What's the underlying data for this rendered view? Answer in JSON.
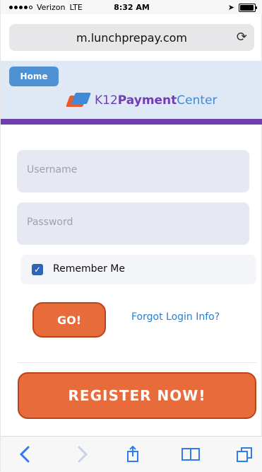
{
  "status_bar": {
    "carrier": "Verizon",
    "network": "LTE",
    "time": "8:32 AM"
  },
  "browser": {
    "url": "m.lunchprepay.com",
    "reload_icon": "reload-icon"
  },
  "header": {
    "home_label": "Home",
    "logo_text_k12": "K12",
    "logo_text_payment": "Payment",
    "logo_text_center": "Center",
    "colors": {
      "header_bg": "#dfe9f6",
      "brand_purple": "#6f3fb1",
      "brand_blue": "#3f8ad6",
      "brand_orange": "#e85b2d"
    }
  },
  "login": {
    "username_placeholder": "Username",
    "password_placeholder": "Password",
    "remember_label": "Remember Me",
    "remember_checked": true,
    "go_label": "GO!",
    "forgot_label": "Forgot Login Info?"
  },
  "register": {
    "label": "REGISTER NOW!"
  },
  "toolbar": {
    "icons": [
      "back-icon",
      "forward-icon",
      "share-icon",
      "bookmarks-icon",
      "tabs-icon"
    ]
  }
}
